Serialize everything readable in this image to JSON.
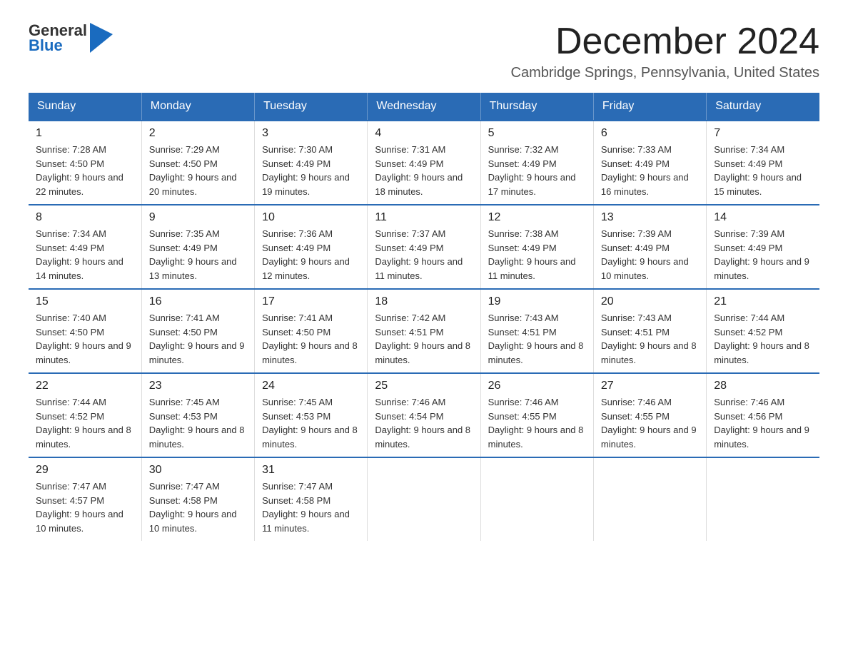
{
  "logo": {
    "text_general": "General",
    "text_blue": "Blue"
  },
  "title": "December 2024",
  "subtitle": "Cambridge Springs, Pennsylvania, United States",
  "days_of_week": [
    "Sunday",
    "Monday",
    "Tuesday",
    "Wednesday",
    "Thursday",
    "Friday",
    "Saturday"
  ],
  "weeks": [
    [
      {
        "day": "1",
        "sunrise": "Sunrise: 7:28 AM",
        "sunset": "Sunset: 4:50 PM",
        "daylight": "Daylight: 9 hours and 22 minutes."
      },
      {
        "day": "2",
        "sunrise": "Sunrise: 7:29 AM",
        "sunset": "Sunset: 4:50 PM",
        "daylight": "Daylight: 9 hours and 20 minutes."
      },
      {
        "day": "3",
        "sunrise": "Sunrise: 7:30 AM",
        "sunset": "Sunset: 4:49 PM",
        "daylight": "Daylight: 9 hours and 19 minutes."
      },
      {
        "day": "4",
        "sunrise": "Sunrise: 7:31 AM",
        "sunset": "Sunset: 4:49 PM",
        "daylight": "Daylight: 9 hours and 18 minutes."
      },
      {
        "day": "5",
        "sunrise": "Sunrise: 7:32 AM",
        "sunset": "Sunset: 4:49 PM",
        "daylight": "Daylight: 9 hours and 17 minutes."
      },
      {
        "day": "6",
        "sunrise": "Sunrise: 7:33 AM",
        "sunset": "Sunset: 4:49 PM",
        "daylight": "Daylight: 9 hours and 16 minutes."
      },
      {
        "day": "7",
        "sunrise": "Sunrise: 7:34 AM",
        "sunset": "Sunset: 4:49 PM",
        "daylight": "Daylight: 9 hours and 15 minutes."
      }
    ],
    [
      {
        "day": "8",
        "sunrise": "Sunrise: 7:34 AM",
        "sunset": "Sunset: 4:49 PM",
        "daylight": "Daylight: 9 hours and 14 minutes."
      },
      {
        "day": "9",
        "sunrise": "Sunrise: 7:35 AM",
        "sunset": "Sunset: 4:49 PM",
        "daylight": "Daylight: 9 hours and 13 minutes."
      },
      {
        "day": "10",
        "sunrise": "Sunrise: 7:36 AM",
        "sunset": "Sunset: 4:49 PM",
        "daylight": "Daylight: 9 hours and 12 minutes."
      },
      {
        "day": "11",
        "sunrise": "Sunrise: 7:37 AM",
        "sunset": "Sunset: 4:49 PM",
        "daylight": "Daylight: 9 hours and 11 minutes."
      },
      {
        "day": "12",
        "sunrise": "Sunrise: 7:38 AM",
        "sunset": "Sunset: 4:49 PM",
        "daylight": "Daylight: 9 hours and 11 minutes."
      },
      {
        "day": "13",
        "sunrise": "Sunrise: 7:39 AM",
        "sunset": "Sunset: 4:49 PM",
        "daylight": "Daylight: 9 hours and 10 minutes."
      },
      {
        "day": "14",
        "sunrise": "Sunrise: 7:39 AM",
        "sunset": "Sunset: 4:49 PM",
        "daylight": "Daylight: 9 hours and 9 minutes."
      }
    ],
    [
      {
        "day": "15",
        "sunrise": "Sunrise: 7:40 AM",
        "sunset": "Sunset: 4:50 PM",
        "daylight": "Daylight: 9 hours and 9 minutes."
      },
      {
        "day": "16",
        "sunrise": "Sunrise: 7:41 AM",
        "sunset": "Sunset: 4:50 PM",
        "daylight": "Daylight: 9 hours and 9 minutes."
      },
      {
        "day": "17",
        "sunrise": "Sunrise: 7:41 AM",
        "sunset": "Sunset: 4:50 PM",
        "daylight": "Daylight: 9 hours and 8 minutes."
      },
      {
        "day": "18",
        "sunrise": "Sunrise: 7:42 AM",
        "sunset": "Sunset: 4:51 PM",
        "daylight": "Daylight: 9 hours and 8 minutes."
      },
      {
        "day": "19",
        "sunrise": "Sunrise: 7:43 AM",
        "sunset": "Sunset: 4:51 PM",
        "daylight": "Daylight: 9 hours and 8 minutes."
      },
      {
        "day": "20",
        "sunrise": "Sunrise: 7:43 AM",
        "sunset": "Sunset: 4:51 PM",
        "daylight": "Daylight: 9 hours and 8 minutes."
      },
      {
        "day": "21",
        "sunrise": "Sunrise: 7:44 AM",
        "sunset": "Sunset: 4:52 PM",
        "daylight": "Daylight: 9 hours and 8 minutes."
      }
    ],
    [
      {
        "day": "22",
        "sunrise": "Sunrise: 7:44 AM",
        "sunset": "Sunset: 4:52 PM",
        "daylight": "Daylight: 9 hours and 8 minutes."
      },
      {
        "day": "23",
        "sunrise": "Sunrise: 7:45 AM",
        "sunset": "Sunset: 4:53 PM",
        "daylight": "Daylight: 9 hours and 8 minutes."
      },
      {
        "day": "24",
        "sunrise": "Sunrise: 7:45 AM",
        "sunset": "Sunset: 4:53 PM",
        "daylight": "Daylight: 9 hours and 8 minutes."
      },
      {
        "day": "25",
        "sunrise": "Sunrise: 7:46 AM",
        "sunset": "Sunset: 4:54 PM",
        "daylight": "Daylight: 9 hours and 8 minutes."
      },
      {
        "day": "26",
        "sunrise": "Sunrise: 7:46 AM",
        "sunset": "Sunset: 4:55 PM",
        "daylight": "Daylight: 9 hours and 8 minutes."
      },
      {
        "day": "27",
        "sunrise": "Sunrise: 7:46 AM",
        "sunset": "Sunset: 4:55 PM",
        "daylight": "Daylight: 9 hours and 9 minutes."
      },
      {
        "day": "28",
        "sunrise": "Sunrise: 7:46 AM",
        "sunset": "Sunset: 4:56 PM",
        "daylight": "Daylight: 9 hours and 9 minutes."
      }
    ],
    [
      {
        "day": "29",
        "sunrise": "Sunrise: 7:47 AM",
        "sunset": "Sunset: 4:57 PM",
        "daylight": "Daylight: 9 hours and 10 minutes."
      },
      {
        "day": "30",
        "sunrise": "Sunrise: 7:47 AM",
        "sunset": "Sunset: 4:58 PM",
        "daylight": "Daylight: 9 hours and 10 minutes."
      },
      {
        "day": "31",
        "sunrise": "Sunrise: 7:47 AM",
        "sunset": "Sunset: 4:58 PM",
        "daylight": "Daylight: 9 hours and 11 minutes."
      },
      null,
      null,
      null,
      null
    ]
  ]
}
